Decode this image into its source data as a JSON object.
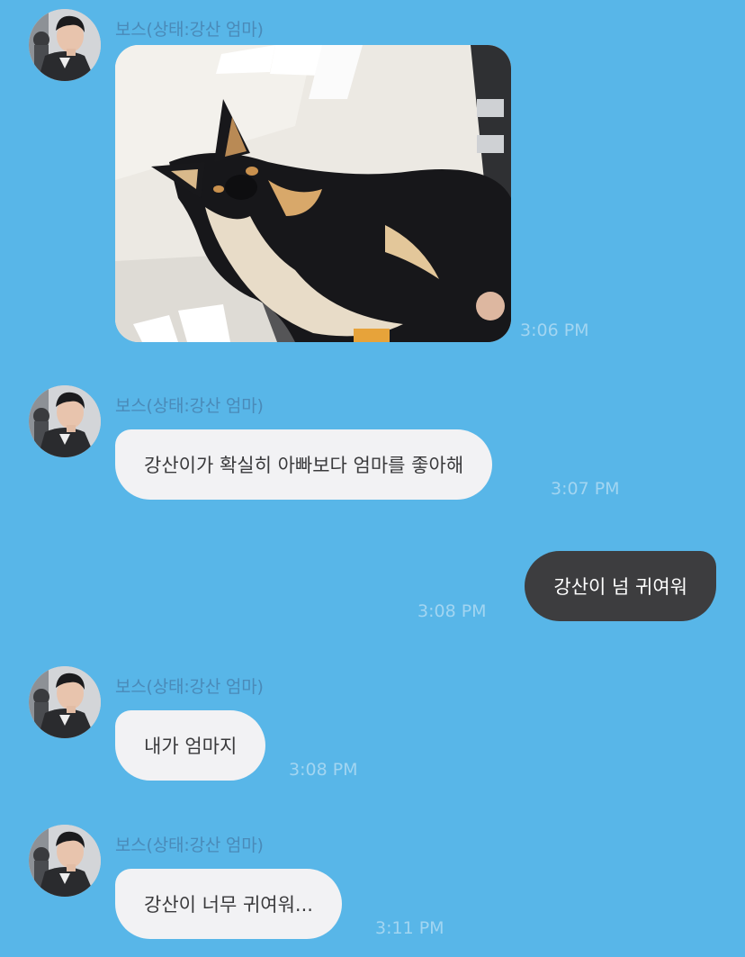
{
  "messages": [
    {
      "type": "photo",
      "sender": "보스(상태:강산 엄마)",
      "time": "3:06 PM",
      "photo_subject": "black-and-tan shiba inu dog"
    },
    {
      "type": "text",
      "direction": "in",
      "sender": "보스(상태:강산 엄마)",
      "text": "강산이가 확실히 아빠보다 엄마를 좋아해",
      "time": "3:07 PM"
    },
    {
      "type": "text",
      "direction": "out",
      "text": "강산이 넘 귀여워",
      "time": "3:08 PM"
    },
    {
      "type": "text",
      "direction": "in",
      "sender": "보스(상태:강산 엄마)",
      "text": "내가 엄마지",
      "time": "3:08 PM"
    },
    {
      "type": "text",
      "direction": "in",
      "sender": "보스(상태:강산 엄마)",
      "text": "강산이 너무 귀여워...",
      "time": "3:11 PM"
    }
  ],
  "colors": {
    "background": "#58b6e8",
    "incoming_bubble": "#f2f2f4",
    "outgoing_bubble": "#3d3d3f",
    "timestamp": "#a2d5f1",
    "sender_name": "#4a8ab8"
  }
}
